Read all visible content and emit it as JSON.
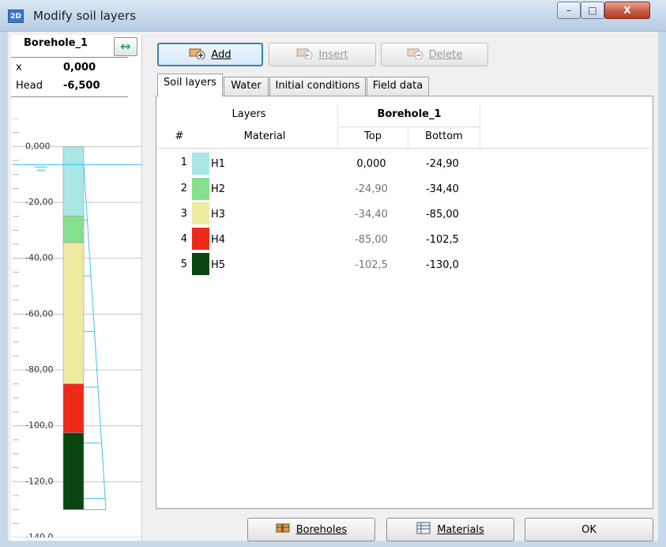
{
  "window": {
    "title": "Modify soil layers",
    "icon_text": "2D",
    "controls": {
      "minimize": "–",
      "maximize": "□",
      "close": "X"
    }
  },
  "borehole_panel": {
    "name": "Borehole_1",
    "swap_icon": "↔",
    "x_label": "x",
    "x_value": "0,000",
    "head_label": "Head",
    "head_value": "-6,500",
    "ruler_labels": [
      "0,000",
      "-20,00",
      "-40,00",
      "-60,00",
      "-80,00",
      "-100,0",
      "-120,0",
      "-140,0"
    ],
    "ruler_range": [
      10,
      -140
    ],
    "water_level": -6.5
  },
  "toolbar": {
    "add": {
      "label": "Add",
      "icon": "add-layer-icon",
      "enabled": true
    },
    "insert": {
      "label": "Insert",
      "icon": "insert-layer-icon",
      "enabled": false
    },
    "delete": {
      "label": "Delete",
      "icon": "delete-layer-icon",
      "enabled": false
    }
  },
  "tabs": [
    {
      "label": "Soil layers",
      "active": true
    },
    {
      "label": "Water",
      "active": false
    },
    {
      "label": "Initial conditions",
      "active": false
    },
    {
      "label": "Field data",
      "active": false
    }
  ],
  "table": {
    "group_layers": "Layers",
    "group_borehole": "Borehole_1",
    "col_num": "#",
    "col_material": "Material",
    "col_top": "Top",
    "col_bottom": "Bottom",
    "rows": [
      {
        "num": "1",
        "material": "H1",
        "top": "0,000",
        "bottom": "-24,90",
        "color": "#a9e6e6",
        "top_value": 0,
        "bottom_value": -24.9,
        "top_editable": true
      },
      {
        "num": "2",
        "material": "H2",
        "top": "-24,90",
        "bottom": "-34,40",
        "color": "#85e08e",
        "top_value": -24.9,
        "bottom_value": -34.4,
        "top_editable": false
      },
      {
        "num": "3",
        "material": "H3",
        "top": "-34,40",
        "bottom": "-85,00",
        "color": "#eeeaa0",
        "top_value": -34.4,
        "bottom_value": -85.0,
        "top_editable": false
      },
      {
        "num": "4",
        "material": "H4",
        "top": "-85,00",
        "bottom": "-102,5",
        "color": "#ee2a1a",
        "top_value": -85.0,
        "bottom_value": -102.5,
        "top_editable": false
      },
      {
        "num": "5",
        "material": "H5",
        "top": "-102,5",
        "bottom": "-130,0",
        "color": "#0a4510",
        "top_value": -102.5,
        "bottom_value": -130.0,
        "top_editable": false
      }
    ]
  },
  "footer": {
    "boreholes": {
      "label": "Boreholes",
      "icon": "boreholes-icon"
    },
    "materials": {
      "label": "Materials",
      "icon": "materials-icon"
    },
    "ok": {
      "label": "OK"
    }
  },
  "colors": {
    "water_line": "#3fc3ee",
    "accent_button_border": "#3c7fb1"
  }
}
